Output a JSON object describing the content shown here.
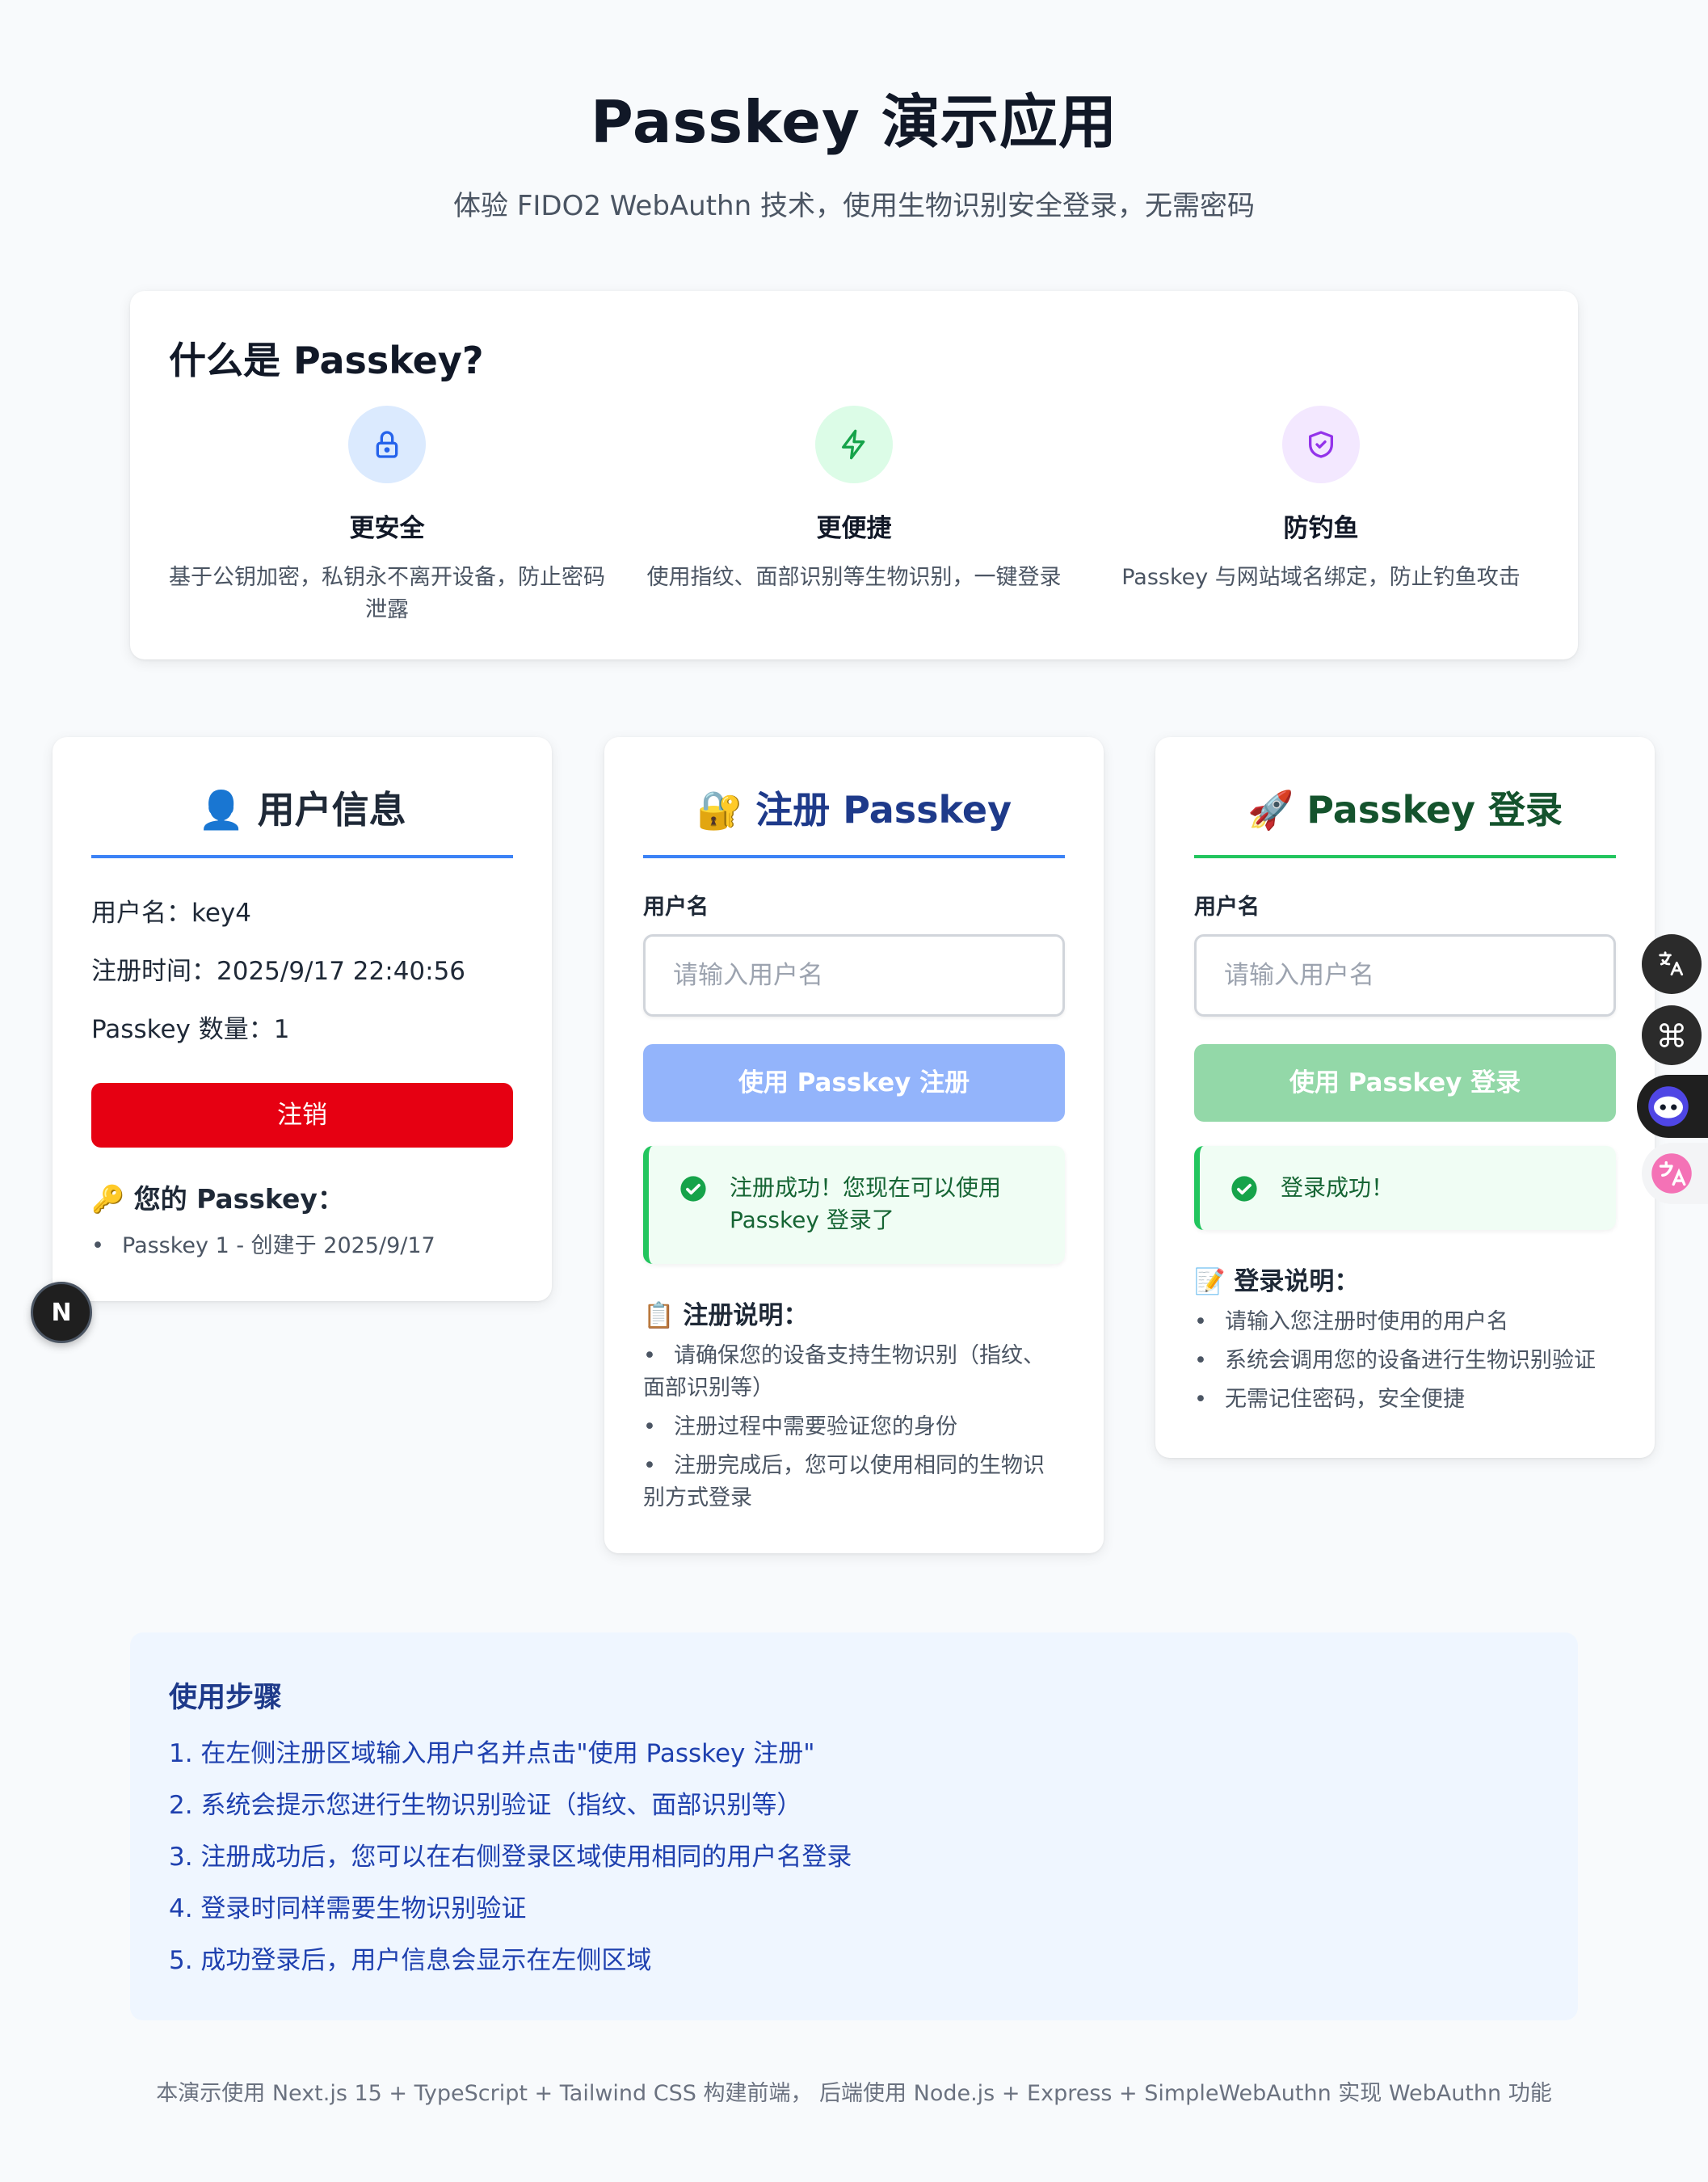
{
  "header": {
    "title": "Passkey 演示应用",
    "subtitle": "体验 FIDO2 WebAuthn 技术，使用生物识别安全登录，无需密码"
  },
  "what": {
    "title": "什么是 Passkey?",
    "features": [
      {
        "icon": "lock-icon",
        "title": "更安全",
        "desc": "基于公钥加密，私钥永不离开设备，防止密码泄露"
      },
      {
        "icon": "lightning-icon",
        "title": "更便捷",
        "desc": "使用指纹、面部识别等生物识别，一键登录"
      },
      {
        "icon": "shield-check-icon",
        "title": "防钓鱼",
        "desc": "Passkey 与网站域名绑定，防止钓鱼攻击"
      }
    ]
  },
  "user_info": {
    "title": "👤 用户信息",
    "username_line": "用户名：key4",
    "registered_line": "注册时间：2025/9/17 22:40:56",
    "count_line": "Passkey 数量：1",
    "logout_label": "注销",
    "passkeys_heading": "🔑 您的 Passkey：",
    "passkeys": [
      "Passkey 1 - 创建于 2025/9/17"
    ]
  },
  "register": {
    "title": "🔐 注册 Passkey",
    "username_label": "用户名",
    "username_placeholder": "请输入用户名",
    "button_label": "使用 Passkey 注册",
    "success_message": "注册成功！您现在可以使用 Passkey 登录了",
    "notes_heading": "📋 注册说明：",
    "notes": [
      "请确保您的设备支持生物识别（指纹、面部识别等）",
      "注册过程中需要验证您的身份",
      "注册完成后，您可以使用相同的生物识别方式登录"
    ]
  },
  "login": {
    "title": "🚀 Passkey 登录",
    "username_label": "用户名",
    "username_placeholder": "请输入用户名",
    "button_label": "使用 Passkey 登录",
    "success_message": "登录成功！",
    "notes_heading": "📝 登录说明：",
    "notes": [
      "请输入您注册时使用的用户名",
      "系统会调用您的设备进行生物识别验证",
      "无需记住密码，安全便捷"
    ]
  },
  "steps": {
    "title": "使用步骤",
    "items": [
      "1. 在左侧注册区域输入用户名并点击\"使用 Passkey 注册\"",
      "2. 系统会提示您进行生物识别验证（指纹、面部识别等）",
      "3. 注册成功后，您可以在右侧登录区域使用相同的用户名登录",
      "4. 登录时同样需要生物识别验证",
      "5. 成功登录后，用户信息会显示在左侧区域"
    ]
  },
  "footer": {
    "text": "本演示使用 Next.js 15 + TypeScript + Tailwind CSS 构建前端， 后端使用 Node.js + Express + SimpleWebAuthn 实现 WebAuthn 功能"
  },
  "floating": {
    "dev_badge": "N",
    "side_icons": [
      "translate-icon",
      "command-icon",
      "assistant-icon",
      "translate-pink-icon"
    ]
  },
  "colors": {
    "primary_blue": "#3b82f6",
    "register_title": "#1e3a8a",
    "login_title": "#14532d",
    "logout_red": "#e60012",
    "register_button": "#93b4fb",
    "login_button": "#93d8a8",
    "success_green": "#22c55e"
  }
}
